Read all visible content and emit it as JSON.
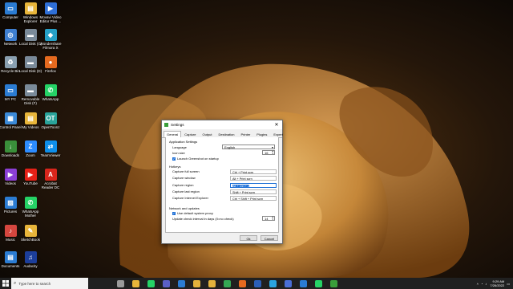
{
  "desktop": {
    "icons": [
      {
        "label": "Computer",
        "color": "#2b7cd3",
        "glyph": "▭"
      },
      {
        "label": "Windows\nExplorer",
        "color": "#e8b53a",
        "glyph": "▤"
      },
      {
        "label": "Movavi Video\nEditor Plus ...",
        "color": "#2f6fd6",
        "glyph": "▶"
      },
      {
        "label": "Network",
        "color": "#3f7fd0",
        "glyph": "◎"
      },
      {
        "label": "Local Disk (C)",
        "color": "#7a8a99",
        "glyph": "▬"
      },
      {
        "label": "Wondershare\nFilmora X",
        "color": "#26a0c6",
        "glyph": "◆"
      },
      {
        "label": "Recycle Bin",
        "color": "#8aa0b0",
        "glyph": "♻"
      },
      {
        "label": "Local Disk (D)",
        "color": "#7a8a99",
        "glyph": "▬"
      },
      {
        "label": "Firefox",
        "color": "#e66a1f",
        "glyph": "●"
      },
      {
        "label": "MY PC",
        "color": "#2b7cd3",
        "glyph": "▭"
      },
      {
        "label": "Removable\nDisk (F)",
        "color": "#7a8a99",
        "glyph": "▬"
      },
      {
        "label": "WhatsApp",
        "color": "#25d366",
        "glyph": "✆"
      },
      {
        "label": "Control Panel",
        "color": "#3b8ad8",
        "glyph": "▦"
      },
      {
        "label": "My Videos",
        "color": "#e8b53a",
        "glyph": "▤"
      },
      {
        "label": "OpenToonz",
        "color": "#2aa39a",
        "glyph": "OT"
      },
      {
        "label": "Downloads",
        "color": "#3a8f3a",
        "glyph": "↓"
      },
      {
        "label": "Zoom",
        "color": "#2d8cff",
        "glyph": "Z"
      },
      {
        "label": "TeamViewer",
        "color": "#0e8ee9",
        "glyph": "⇄"
      },
      {
        "label": "Videos",
        "color": "#8c3fd6",
        "glyph": "▶"
      },
      {
        "label": "YouTube",
        "color": "#e62117",
        "glyph": "▶"
      },
      {
        "label": "Acrobat\nReader DC",
        "color": "#d9261c",
        "glyph": "A"
      },
      {
        "label": "Pictures",
        "color": "#2b7cd3",
        "glyph": "▨"
      },
      {
        "label": "WhatsApp\nMother",
        "color": "#25d366",
        "glyph": "✆"
      },
      {
        "label": "Music",
        "color": "#d6473f",
        "glyph": "♪"
      },
      {
        "label": "SketchBook",
        "color": "#e8b53a",
        "glyph": "✎"
      },
      {
        "label": "Documents",
        "color": "#2b7cd3",
        "glyph": "▤"
      },
      {
        "label": "Audacity",
        "color": "#1c3e9a",
        "glyph": "♫"
      }
    ]
  },
  "window": {
    "title": "Settings",
    "tabs": [
      "General",
      "Capture",
      "Output",
      "Destination",
      "Printer",
      "Plugins",
      "Expert"
    ],
    "app_settings_heading": "Application Settings",
    "language_label": "Language",
    "language_value": "English",
    "icon_size_label": "Icon size",
    "icon_size_value": "16",
    "launch_label": "Launch Greenshot on startup",
    "hotkeys_heading": "Hotkeys",
    "hotkeys": [
      {
        "label": "Capture full screen",
        "value": "Ctrl + Print scrn"
      },
      {
        "label": "Capture window",
        "value": "Alt + Print scrn"
      },
      {
        "label": "Capture region",
        "value": "Alt + Ctrl + 2"
      },
      {
        "label": "Capture last region",
        "value": "Shift + Print scrn"
      },
      {
        "label": "Capture Internet Explorer",
        "value": "Ctrl + Shift + Print scrn"
      }
    ],
    "network_heading": "Network and updates",
    "proxy_label": "Use default system proxy",
    "update_label": "Update check interval in days (0=no check)",
    "update_value": "14",
    "ok_label": "Ok",
    "cancel_label": "Cancel"
  },
  "taskbar": {
    "search_placeholder": "Type here to search",
    "apps": [
      {
        "name": "task-view",
        "color": "#9a9a9a"
      },
      {
        "name": "file-explorer",
        "color": "#e8b53a"
      },
      {
        "name": "whatsapp",
        "color": "#25d366"
      },
      {
        "name": "teams",
        "color": "#5b5fc7"
      },
      {
        "name": "store",
        "color": "#2b7cd3"
      },
      {
        "name": "chrome-1",
        "color": "#e3b23c"
      },
      {
        "name": "chrome-2",
        "color": "#e3b23c"
      },
      {
        "name": "chrome-3",
        "color": "#34a853"
      },
      {
        "name": "firefox",
        "color": "#e66a1f"
      },
      {
        "name": "word",
        "color": "#2b5eb7"
      },
      {
        "name": "telegram",
        "color": "#2aa3e0"
      },
      {
        "name": "media",
        "color": "#4a6ed6"
      },
      {
        "name": "network",
        "color": "#2b7cd3"
      },
      {
        "name": "whatsapp-2",
        "color": "#25d366"
      },
      {
        "name": "greenshot",
        "color": "#3a9e3a"
      }
    ],
    "time": "9:29 AM",
    "date": "7/26/2022"
  }
}
